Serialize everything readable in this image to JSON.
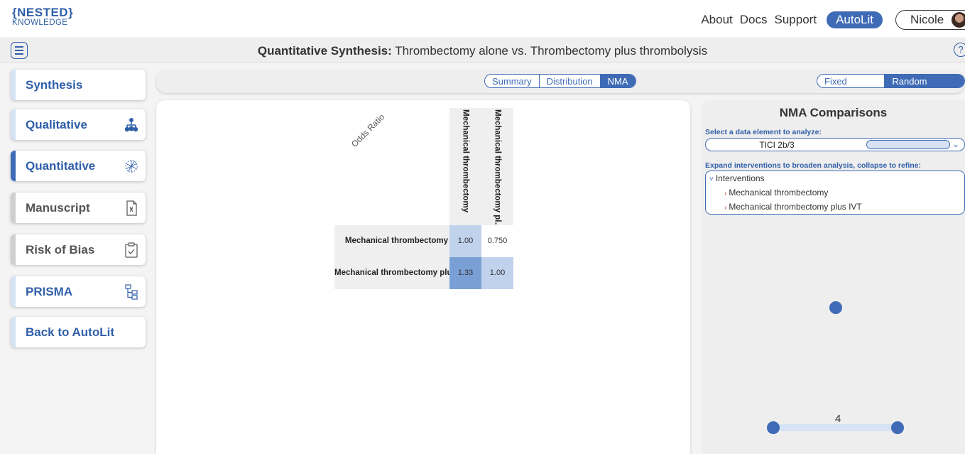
{
  "header": {
    "logo_line1": "{NESTED}",
    "logo_line2": "KNOWLEDGE",
    "nav": [
      "About",
      "Docs",
      "Support"
    ],
    "autolit_label": "AutoLit",
    "user_name": "Nicole"
  },
  "titlebar": {
    "title_bold": "Quantitative Synthesis:",
    "title_rest": " Thrombectomy alone vs. Thrombectomy plus thrombolysis",
    "help_label": "?"
  },
  "sidebar": {
    "items": [
      {
        "label": "Synthesis",
        "icon": "none"
      },
      {
        "label": "Qualitative",
        "icon": "hierarchy-icon"
      },
      {
        "label": "Quantitative",
        "icon": "starburst-icon"
      },
      {
        "label": "Manuscript",
        "icon": "document-icon"
      },
      {
        "label": "Risk of Bias",
        "icon": "clipboard-check-icon"
      },
      {
        "label": "PRISMA",
        "icon": "flowchart-icon"
      },
      {
        "label": "Back to AutoLit",
        "icon": "none"
      }
    ]
  },
  "view_tabs": {
    "items": [
      "Summary",
      "Distribution",
      "NMA"
    ],
    "selected": "NMA"
  },
  "effects_tabs": {
    "items": [
      "Fixed Effects",
      "Random Effects"
    ],
    "selected": "Random Effects"
  },
  "matrix": {
    "metric_label": "Odds Ratio",
    "columns": [
      "Mechanical thrombectomy",
      "Mechanical thrombectomy pl..."
    ],
    "rows": [
      "Mechanical thrombectomy",
      "Mechanical thrombectomy plus"
    ],
    "values": [
      [
        "1.00",
        "0.750"
      ],
      [
        "1.33",
        "1.00"
      ]
    ]
  },
  "nma": {
    "title": "NMA Comparisons",
    "select_hint": "Select a data element to analyze:",
    "selected_element": "TICI 2b/3",
    "expand_hint": "Expand interventions to broaden analysis, collapse to refine:",
    "tree": {
      "root": "Interventions",
      "children": [
        "Mechanical thrombectomy",
        "Mechanical thrombectomy plus IVT"
      ]
    },
    "network_edge_label": "4"
  },
  "colors": {
    "accent": "#3f6bb6",
    "light_accent": "#d6e3f5",
    "cell_diag": "#c0d2ec",
    "cell_strong": "#7a9fd4"
  }
}
